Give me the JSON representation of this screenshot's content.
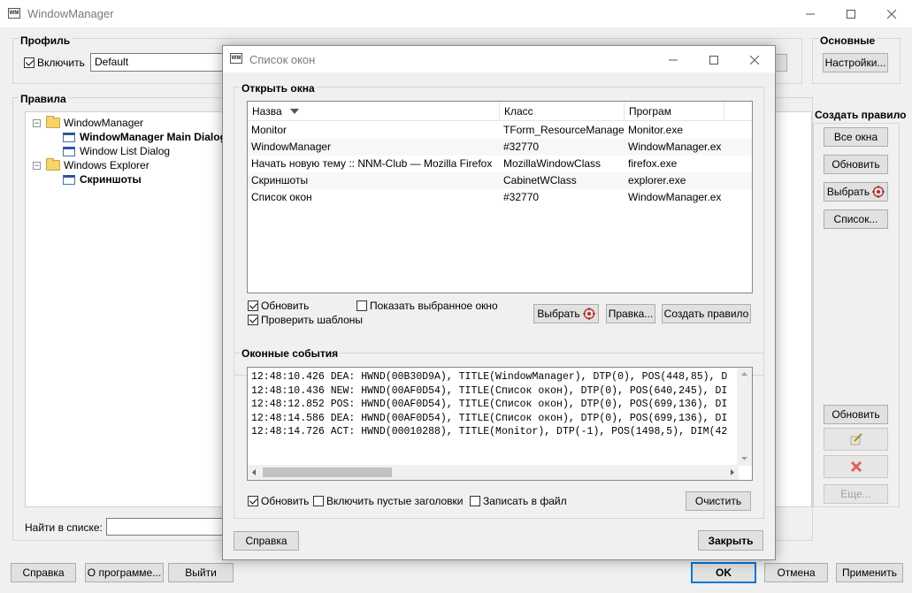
{
  "main": {
    "title": "WindowManager",
    "profile": {
      "group_title": "Профиль",
      "enable_label": "Включить",
      "enable_checked": true,
      "profile_value": "Default"
    },
    "basic": {
      "group_title": "Основные",
      "settings_button": "Настройки..."
    },
    "rules": {
      "group_title": "Правила",
      "tree": [
        {
          "label": "WindowManager",
          "type": "folder",
          "expander": "−",
          "bold": false
        },
        {
          "label": "WindowManager Main Dialog",
          "type": "window",
          "bold": true
        },
        {
          "label": "Window List Dialog",
          "type": "window",
          "bold": false
        },
        {
          "label": "Windows Explorer",
          "type": "folder",
          "expander": "−",
          "bold": false
        },
        {
          "label": "Скриншоты",
          "type": "window",
          "bold": true
        }
      ],
      "search_label": "Найти в списке:",
      "search_value": ""
    },
    "create_rule": {
      "group_title": "Создать правило",
      "all_windows": "Все окна",
      "refresh": "Обновить",
      "pick": "Выбрать",
      "list": "Список...",
      "refresh2": "Обновить",
      "more": "Еще..."
    },
    "bottom": {
      "help": "Справка",
      "about": "О программе...",
      "exit": "Выйти",
      "ok": "OK",
      "cancel": "Отмена",
      "apply": "Применить"
    }
  },
  "dialog": {
    "title": "Список окон",
    "open_windows": {
      "group_title": "Открыть окна",
      "columns": [
        "Назва",
        "Класс",
        "Програм"
      ],
      "rows": [
        [
          "Monitor",
          "TForm_ResourceManage",
          "Monitor.exe"
        ],
        [
          "WindowManager",
          "#32770",
          "WindowManager.ex"
        ],
        [
          "Начать новую тему :: NNM-Club — Mozilla Firefox",
          "MozillaWindowClass",
          "firefox.exe"
        ],
        [
          "Скриншоты",
          "CabinetWClass",
          "explorer.exe"
        ],
        [
          "Список окон",
          "#32770",
          "WindowManager.ex"
        ]
      ],
      "refresh_label": "Обновить",
      "refresh_checked": true,
      "show_selected_label": "Показать выбранное окно",
      "show_selected_checked": false,
      "check_templates_label": "Проверить шаблоны",
      "check_templates_checked": true,
      "pick_button": "Выбрать",
      "edit_button": "Правка...",
      "create_rule_button": "Создать правило"
    },
    "events": {
      "group_title": "Оконные события",
      "lines": [
        "12:48:10.426 DEA: HWND(00B30D9A), TITLE(WindowManager), DTP(0), POS(448,85), D",
        "12:48:10.436 NEW: HWND(00AF0D54), TITLE(Список окон), DTP(0), POS(640,245), DI",
        "12:48:12.852 POS: HWND(00AF0D54), TITLE(Список окон), DTP(0), POS(699,136), DI",
        "12:48:14.586 DEA: HWND(00AF0D54), TITLE(Список окон), DTP(0), POS(699,136), DI",
        "12:48:14.726 ACT: HWND(00010288), TITLE(Monitor), DTP(-1), POS(1498,5), DIM(42"
      ],
      "refresh_label": "Обновить",
      "refresh_checked": true,
      "empty_titles_label": "Включить пустые заголовки",
      "empty_titles_checked": false,
      "write_file_label": "Записать в файл",
      "write_file_checked": false,
      "clear_button": "Очистить"
    },
    "help_button": "Справка",
    "close_button": "Закрыть"
  },
  "colors": {
    "accent": "#0078d7",
    "folder": "#f6d46b",
    "delete_red": "#e06060"
  }
}
